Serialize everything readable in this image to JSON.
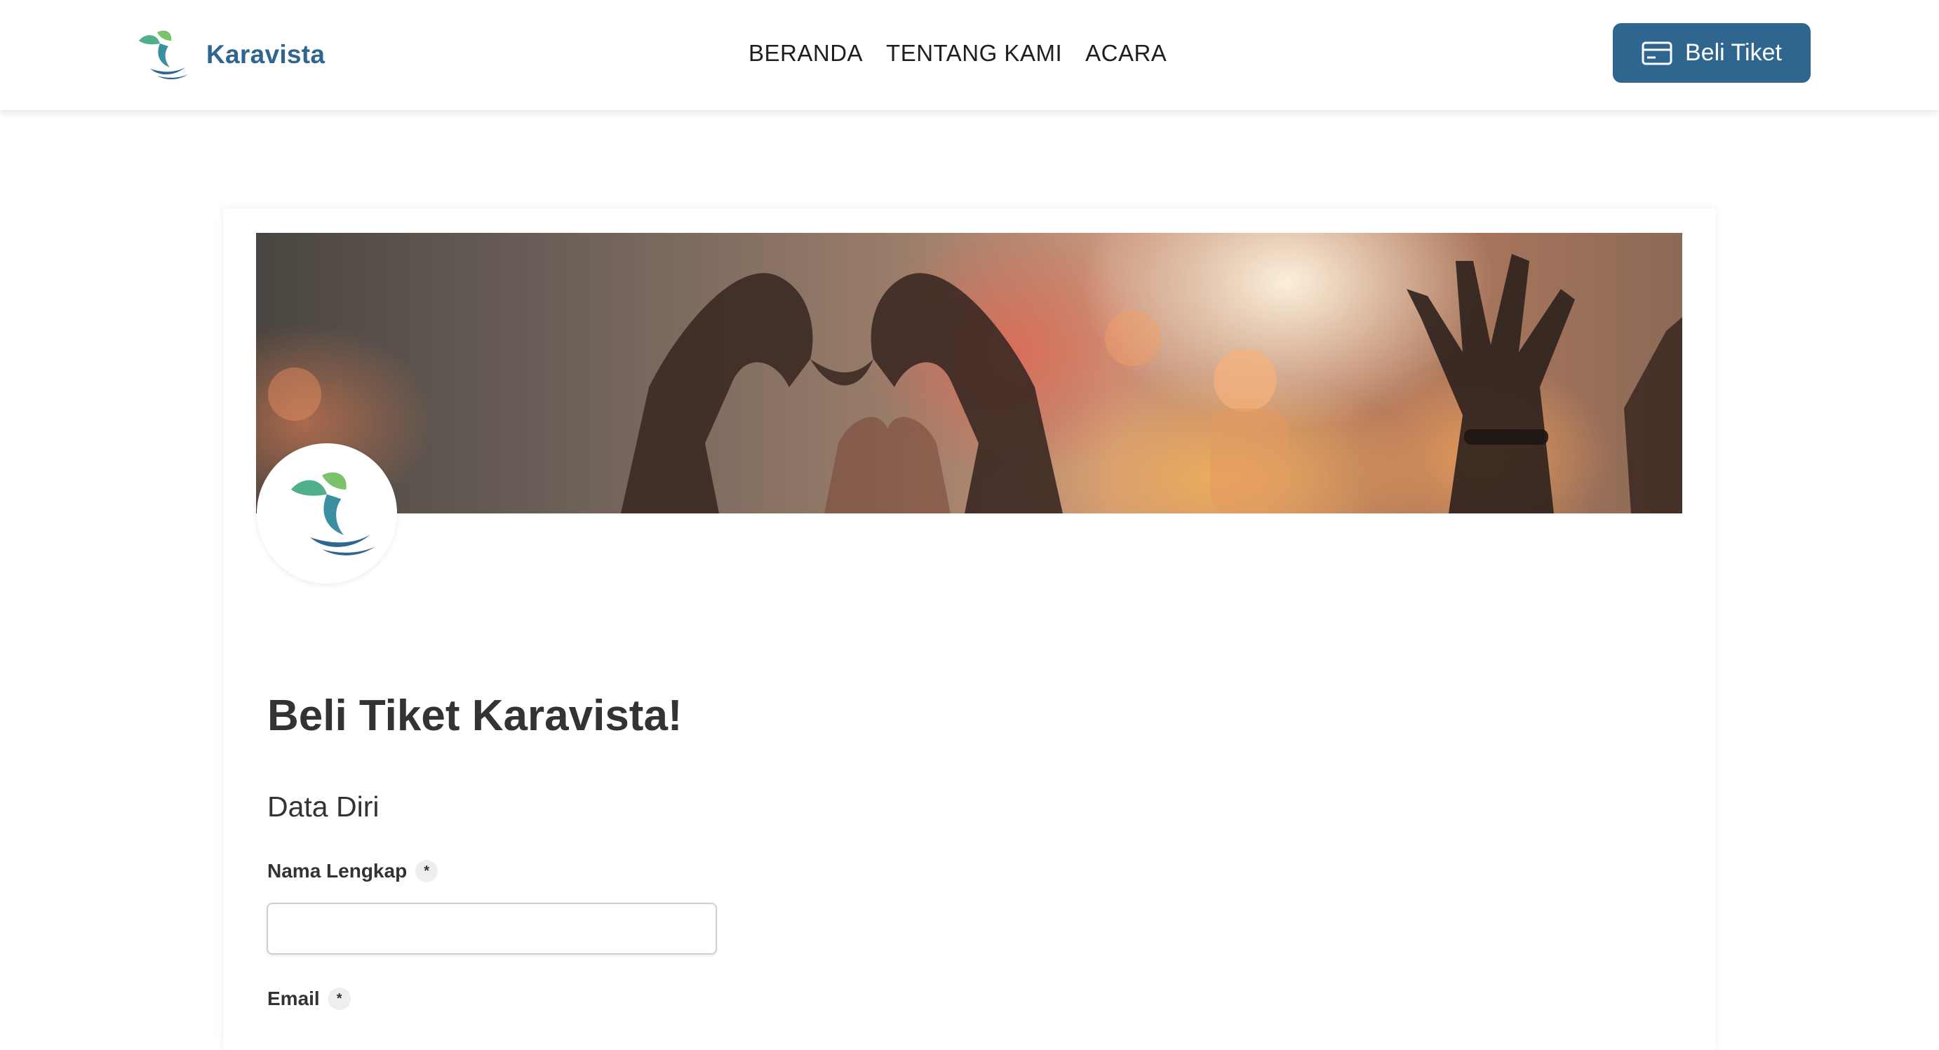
{
  "header": {
    "brand_name": "Karavista",
    "nav": [
      {
        "label": "BERANDA"
      },
      {
        "label": "TENTANG KAMI"
      },
      {
        "label": "ACARA"
      }
    ],
    "buy_button_label": "Beli Tiket"
  },
  "form": {
    "title": "Beli Tiket Karavista!",
    "section_title": "Data Diri",
    "fields": [
      {
        "label": "Nama Lengkap",
        "required_mark": "*",
        "value": ""
      },
      {
        "label": "Email",
        "required_mark": "*"
      }
    ]
  },
  "icons": {
    "brand_logo": "leaf-bird-logo-icon",
    "buy_button_icon": "credit-card-icon"
  },
  "colors": {
    "primary": "#2f6690",
    "logo_teal": "#4fb08a",
    "logo_green": "#7ac36a"
  }
}
